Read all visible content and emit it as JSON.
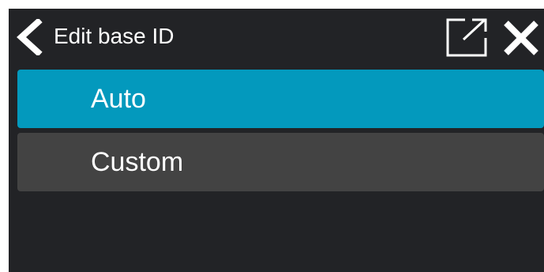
{
  "header": {
    "title": "Edit base ID",
    "back_icon": "chevron-left-icon",
    "expand_icon": "external-link-icon",
    "close_icon": "close-icon"
  },
  "options": [
    {
      "label": "Auto",
      "selected": true
    },
    {
      "label": "Custom",
      "selected": false
    }
  ],
  "colors": {
    "background": "#222326",
    "selected": "#0399bd",
    "unselected": "#434343",
    "text": "#ffffff"
  }
}
